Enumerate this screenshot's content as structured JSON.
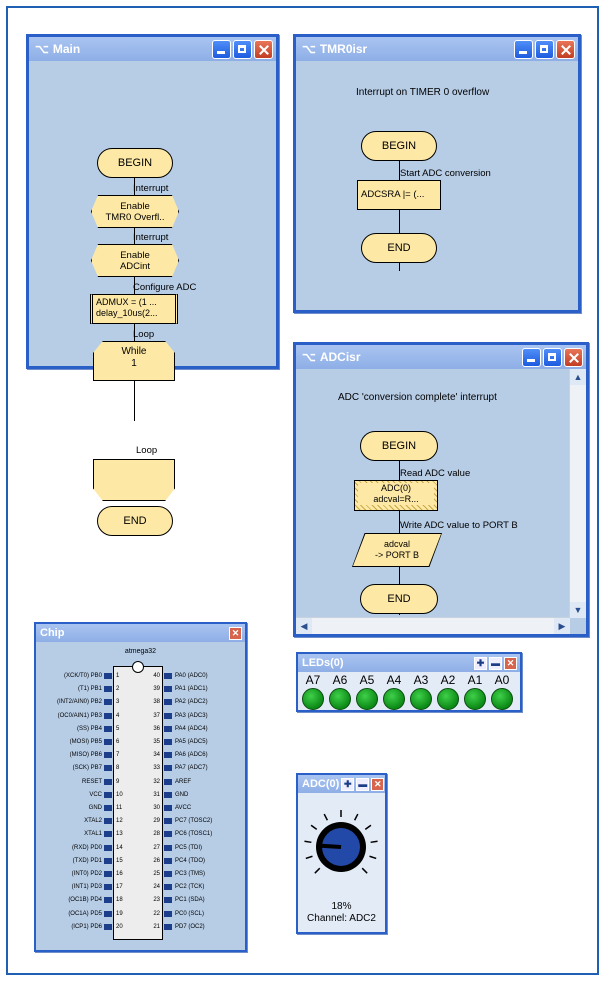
{
  "main": {
    "title": "Main",
    "begin": "BEGIN",
    "note_interrupt1": "Interrupt",
    "enable1_line1": "Enable",
    "enable1_line2": "TMR0 Overfl..",
    "note_interrupt2": "Interrupt",
    "enable2_line1": "Enable",
    "enable2_line2": "ADCint",
    "note_configure": "Configure ADC",
    "admux_line1": "ADMUX = (1 ...",
    "admux_line2": "delay_10us(2...",
    "note_loop1": "Loop",
    "while_line1": "While",
    "while_line2": "1",
    "note_loop2": "Loop",
    "end": "END"
  },
  "tmr": {
    "title": "TMR0isr",
    "caption": "Interrupt on TIMER 0 overflow",
    "begin": "BEGIN",
    "note": "Start ADC conversion",
    "proc": "ADCSRA |= (...",
    "end": "END"
  },
  "adc": {
    "title": "ADCisr",
    "caption": "ADC 'conversion complete' interrupt",
    "begin": "BEGIN",
    "note_read": "Read ADC value",
    "proc_line1": "ADC(0)",
    "proc_line2": "adcval=R...",
    "note_write": "Write ADC value to PORT B",
    "out_line1": "adcval",
    "out_line2": "-> PORT B",
    "end": "END"
  },
  "chip": {
    "title": "Chip",
    "part": "atmega32",
    "left_pins": [
      {
        "label": "(XCK/T0) PB0",
        "num": "1"
      },
      {
        "label": "(T1) PB1",
        "num": "2"
      },
      {
        "label": "(INT2/AIN0) PB2",
        "num": "3"
      },
      {
        "label": "(OC0/AIN1) PB3",
        "num": "4"
      },
      {
        "label": "(SS) PB4",
        "num": "5"
      },
      {
        "label": "(MOSI) PB5",
        "num": "6"
      },
      {
        "label": "(MISO) PB6",
        "num": "7"
      },
      {
        "label": "(SCK) PB7",
        "num": "8"
      },
      {
        "label": "RESET",
        "num": "9"
      },
      {
        "label": "VCC",
        "num": "10"
      },
      {
        "label": "GND",
        "num": "11"
      },
      {
        "label": "XTAL2",
        "num": "12"
      },
      {
        "label": "XTAL1",
        "num": "13"
      },
      {
        "label": "(RXD) PD0",
        "num": "14"
      },
      {
        "label": "(TXD) PD1",
        "num": "15"
      },
      {
        "label": "(INT0) PD2",
        "num": "16"
      },
      {
        "label": "(INT1) PD3",
        "num": "17"
      },
      {
        "label": "(OC1B) PD4",
        "num": "18"
      },
      {
        "label": "(OC1A) PD5",
        "num": "19"
      },
      {
        "label": "(ICP1) PD6",
        "num": "20"
      }
    ],
    "right_pins": [
      {
        "label": "PA0 (ADC0)",
        "num": "40"
      },
      {
        "label": "PA1 (ADC1)",
        "num": "39"
      },
      {
        "label": "PA2 (ADC2)",
        "num": "38"
      },
      {
        "label": "PA3 (ADC3)",
        "num": "37"
      },
      {
        "label": "PA4 (ADC4)",
        "num": "36"
      },
      {
        "label": "PA5 (ADC5)",
        "num": "35"
      },
      {
        "label": "PA6 (ADC6)",
        "num": "34"
      },
      {
        "label": "PA7 (ADC7)",
        "num": "33"
      },
      {
        "label": "AREF",
        "num": "32"
      },
      {
        "label": "GND",
        "num": "31"
      },
      {
        "label": "AVCC",
        "num": "30"
      },
      {
        "label": "PC7 (TOSC2)",
        "num": "29"
      },
      {
        "label": "PC6 (TOSC1)",
        "num": "28"
      },
      {
        "label": "PC5 (TDI)",
        "num": "27"
      },
      {
        "label": "PC4 (TDO)",
        "num": "26"
      },
      {
        "label": "PC3 (TMS)",
        "num": "25"
      },
      {
        "label": "PC2 (TCK)",
        "num": "24"
      },
      {
        "label": "PC1 (SDA)",
        "num": "23"
      },
      {
        "label": "PC0 (SCL)",
        "num": "22"
      },
      {
        "label": "PD7 (OC2)",
        "num": "21"
      }
    ]
  },
  "led": {
    "title": "LEDs(0)",
    "labels": [
      "A7",
      "A6",
      "A5",
      "A4",
      "A3",
      "A2",
      "A1",
      "A0"
    ]
  },
  "adcknob": {
    "title": "ADC(0)",
    "percent": "18%",
    "channel": "Channel: ADC2",
    "level": 0.18
  },
  "colors": {
    "title_active": "#1552d6",
    "window_bg": "#b7cde6",
    "shape_fill": "#fde9a5",
    "led_green": "#13a51f",
    "knob_blue": "#2248a8"
  }
}
